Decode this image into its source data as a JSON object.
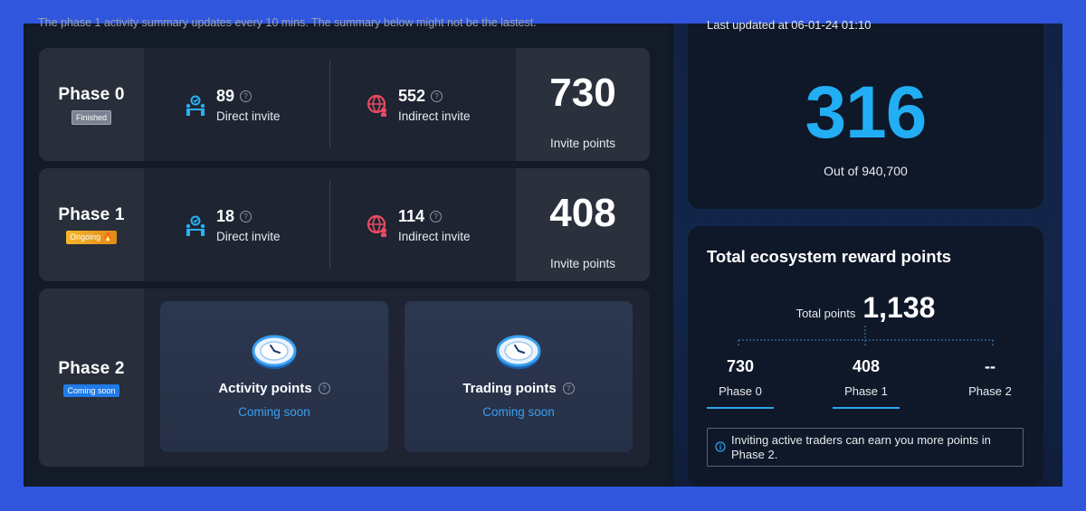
{
  "notice": "The phase 1 activity summary updates every 10 mins. The summary below might not be the lastest.",
  "phases": [
    {
      "title": "Phase 0",
      "badge": "Finished",
      "direct": {
        "value": "89",
        "label": "Direct invite"
      },
      "indirect": {
        "value": "552",
        "label": "Indirect invite"
      },
      "points": {
        "value": "730",
        "label": "Invite points"
      }
    },
    {
      "title": "Phase 1",
      "badge": "Ongoing 🔥",
      "direct": {
        "value": "18",
        "label": "Direct invite"
      },
      "indirect": {
        "value": "114",
        "label": "Indirect invite"
      },
      "points": {
        "value": "408",
        "label": "Invite points"
      }
    },
    {
      "title": "Phase 2",
      "badge": "Coming soon",
      "activity": {
        "title": "Activity points",
        "status": "Coming soon"
      },
      "trading": {
        "title": "Trading points",
        "status": "Coming soon"
      }
    }
  ],
  "rank": {
    "last_updated": "Last updated at 06-01-24 01:10",
    "value": "316",
    "out_of": "Out of 940,700"
  },
  "reward": {
    "title": "Total ecosystem reward points",
    "total_label": "Total points",
    "total_value": "1,138",
    "breakdown": [
      {
        "value": "730",
        "label": "Phase 0"
      },
      {
        "value": "408",
        "label": "Phase 1"
      },
      {
        "value": "--",
        "label": "Phase 2"
      }
    ],
    "info": "Inviting active traders can earn you more points in Phase 2."
  },
  "colors": {
    "accent": "#22aef5",
    "background": "#2f56dd",
    "panel": "#131a28"
  },
  "icons": {
    "direct": "people-invite-icon",
    "indirect": "globe-invite-icon",
    "help": "question-icon",
    "coin": "clock-coin-icon",
    "info": "info-icon"
  }
}
